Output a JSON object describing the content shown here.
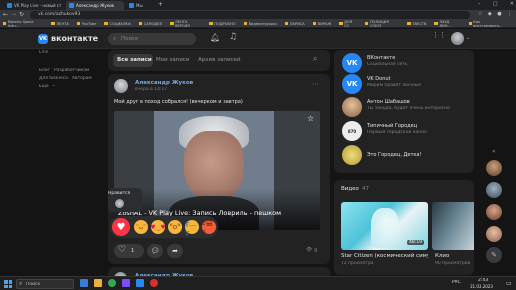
{
  "browser": {
    "tabs": [
      {
        "title": "VK Play Live - новый стриминг",
        "active": false,
        "color": "#1e88e5"
      },
      {
        "title": "Александр Жуков",
        "active": true,
        "color": "#2787f5"
      },
      {
        "title": "Мы",
        "active": false,
        "color": "#2787f5"
      }
    ],
    "address": "vk.com/azhukov93",
    "bookmarks": [
      "Roberts Space Indu...",
      "ЛЕНТА",
      "YouTube",
      "СОЦИАЛКИ",
      "САМОДЕЛ",
      "ЛЕНТА ВЕРСИЯ",
      "ПОДРОБНО",
      "Видеоигрушки",
      "ЛАРИСА",
      "ВИРАЖ",
      "ДЛЯ СС",
      "ПОЛИЦИЯ СОЮЗ",
      "ТВЕСТВ",
      "ЛАУД ДИН...",
      "Как восстановить..."
    ],
    "bookmarks_color": "#e8b339"
  },
  "vk": {
    "logo_text": "вконтакте",
    "search_placeholder": "Поиск",
    "accent": "#2787f5",
    "partial_left_label": "Line"
  },
  "left_menu": {
    "items": [
      "Блог",
      "Разработчикам",
      "Для бизнеса",
      "Авторам",
      "Ещё"
    ]
  },
  "wall_tabs": {
    "tabs": [
      "Все записи",
      "Мои записи",
      "Архив записей"
    ],
    "active_index": 0
  },
  "post": {
    "author": "Александр Жуков",
    "time": "вчера в 14:17",
    "text": "Мой друг в поход собрался! (вечерком и завтра)",
    "likes_tooltip": "Нравится",
    "video_title": "ZoshAL - VK Play Live: Запись Ловриль - пешком",
    "like_count": "1",
    "views": "9",
    "reactions": [
      "heart",
      "laugh",
      "love-eyes",
      "wow",
      "sad",
      "angry"
    ],
    "next_author_partial": "Александр Жуков"
  },
  "right_list": {
    "items": [
      {
        "name": "ВКонтакте",
        "sub": "Социальная сеть",
        "color": "#2787f5"
      },
      {
        "name": "VK Donut",
        "sub": "Мирим правят лючные",
        "color": "#2787f5"
      },
      {
        "name": "Антон Шабашов",
        "sub": "Ты зануда, будет очень интересно",
        "color": "#b8865a"
      },
      {
        "name": "Типичный Городец",
        "sub": "Первый городской канал",
        "color": "#e8e8e8"
      },
      {
        "name": "Это Городец, Детка!",
        "sub": "",
        "color": "#d9c25a"
      }
    ]
  },
  "videos": {
    "header": "Видео",
    "count": "47",
    "items": [
      {
        "title": "Star Citizen (космический симу...",
        "views": "72 просмотра",
        "duration": "48:19"
      },
      {
        "title": "Клио",
        "views": "90 просмотров",
        "duration": ""
      }
    ]
  },
  "taskbar": {
    "search_label": "Поиск",
    "time": "2:43",
    "date": "31.03.2023",
    "lang": "РУС"
  }
}
